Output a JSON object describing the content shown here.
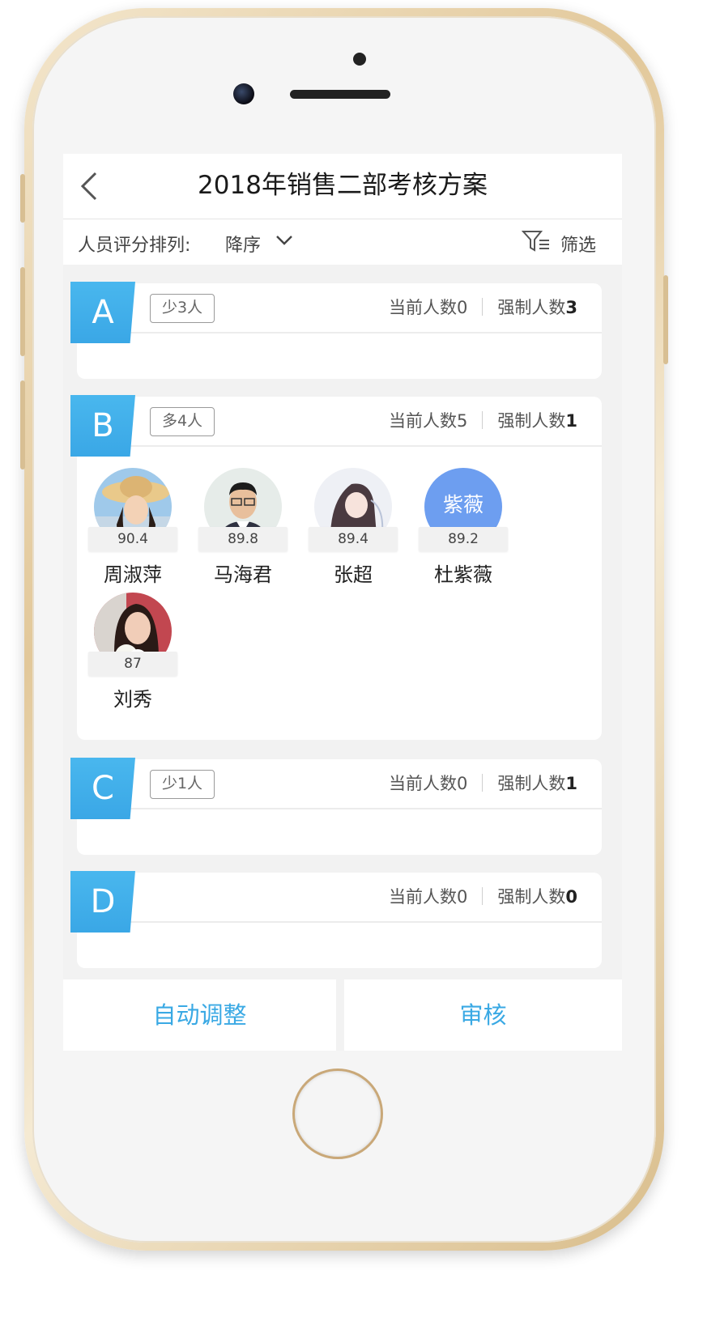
{
  "nav": {
    "title": "2018年销售二部考核方案"
  },
  "sortbar": {
    "label": "人员评分排列:",
    "value": "降序",
    "filter_label": "筛选"
  },
  "groups": [
    {
      "grade": "A",
      "badge": "少3人",
      "current_label": "当前人数0",
      "forced_label": "强制人数",
      "forced_value": "3"
    },
    {
      "grade": "B",
      "badge": "多4人",
      "current_label": "当前人数5",
      "forced_label": "强制人数",
      "forced_value": "1",
      "people": [
        {
          "name": "周淑萍",
          "score": "90.4"
        },
        {
          "name": "马海君",
          "score": "89.8"
        },
        {
          "name": "张超",
          "score": "89.4"
        },
        {
          "name": "杜紫薇",
          "score": "89.2",
          "avatar_text": "紫薇"
        },
        {
          "name": "刘秀",
          "score": "87"
        }
      ]
    },
    {
      "grade": "C",
      "badge": "少1人",
      "current_label": "当前人数0",
      "forced_label": "强制人数",
      "forced_value": "1"
    },
    {
      "grade": "D",
      "badge": "",
      "current_label": "当前人数0",
      "forced_label": "强制人数",
      "forced_value": "0"
    }
  ],
  "actions": {
    "auto_adjust": "自动调整",
    "review": "审核"
  },
  "colors": {
    "accent": "#3aa9e4",
    "grade_tab": "#45b3ec",
    "text_avatar": "#6d9ef0"
  }
}
